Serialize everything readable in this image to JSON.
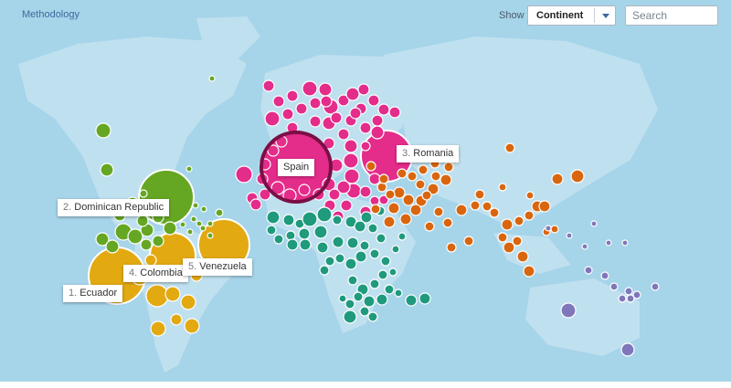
{
  "toolbar": {
    "methodology_link": "Methodology",
    "show_label": "Show",
    "continent_selected": "Continent",
    "search_placeholder": "Search"
  },
  "colors": {
    "ocean": "#a6d4e9",
    "land": "#bfe0ef",
    "south_america": "#e3a911",
    "caribbean_north_america": "#65a722",
    "europe": "#e42c8a",
    "africa": "#1f9a7c",
    "asia": "#d9660e",
    "oceania": "#8077bb"
  },
  "labels": {
    "spain": {
      "name": "Spain"
    },
    "romania": {
      "rank": "3.",
      "name": "Romania"
    },
    "dominican_republic": {
      "rank": "2.",
      "name": "Dominican Republic"
    },
    "colombia": {
      "rank": "4.",
      "name": "Colombia"
    },
    "venezuela": {
      "rank": "5.",
      "name": "Venezuela"
    },
    "ecuador": {
      "rank": "1.",
      "name": "Ecuador"
    }
  }
}
